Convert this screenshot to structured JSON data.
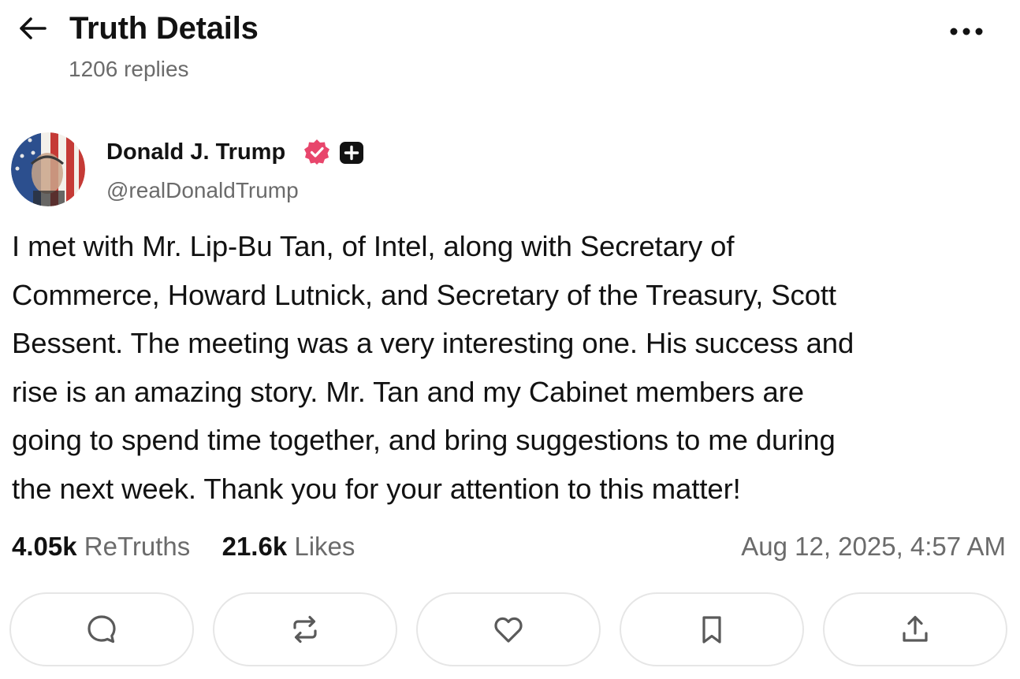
{
  "header": {
    "title": "Truth Details",
    "replies": "1206 replies"
  },
  "author": {
    "name": "Donald J. Trump",
    "handle": "@realDonaldTrump",
    "verified_color": "#e8466c"
  },
  "post": {
    "lines": [
      "I met with Mr. Lip-Bu Tan, of Intel, along with Secretary of",
      "Commerce, Howard Lutnick, and Secretary of the Treasury, Scott",
      "Bessent. The meeting was a very interesting one. His success and",
      "rise is an amazing story. Mr. Tan and my Cabinet members are",
      "going to spend time together, and bring suggestions to me during",
      "the next week. Thank you for your attention to this matter!"
    ]
  },
  "stats": {
    "retruths_count": "4.05k",
    "retruths_label": "ReTruths",
    "likes_count": "21.6k",
    "likes_label": "Likes",
    "timestamp": "Aug 12, 2025, 4:57 AM"
  },
  "actions": [
    {
      "icon": "reply-icon"
    },
    {
      "icon": "retruth-icon"
    },
    {
      "icon": "like-icon"
    },
    {
      "icon": "bookmark-icon"
    },
    {
      "icon": "share-icon"
    }
  ]
}
